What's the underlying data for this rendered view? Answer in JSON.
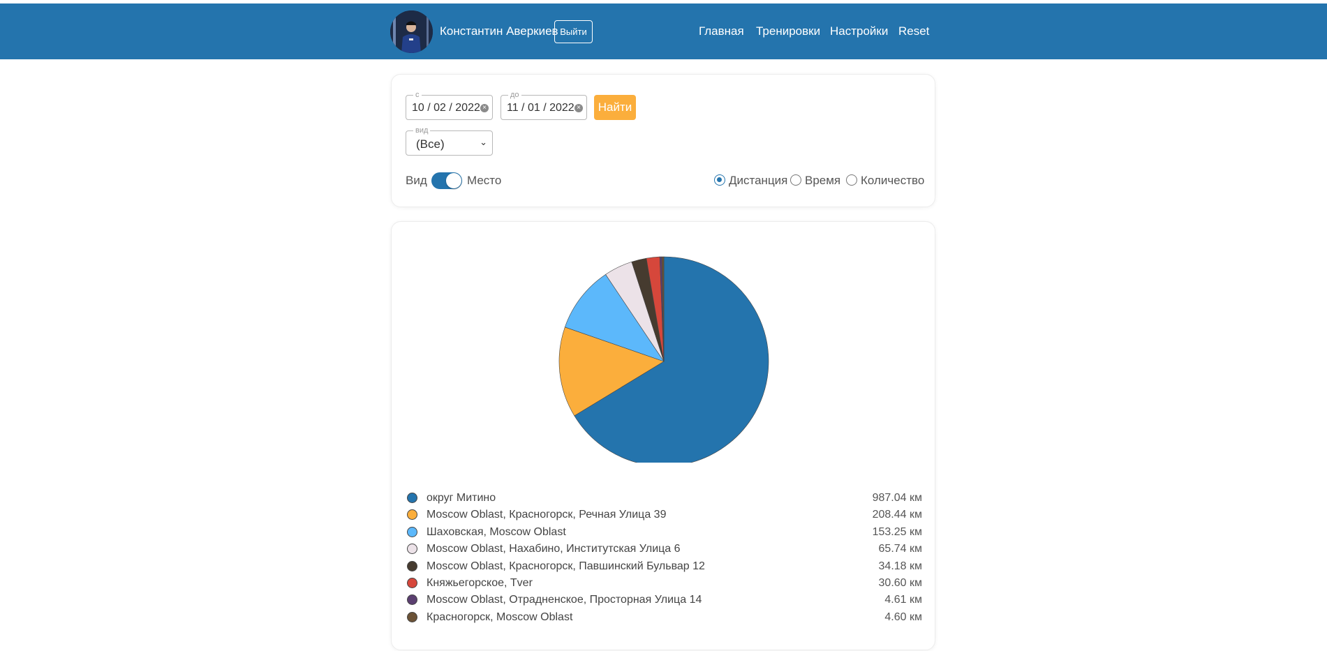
{
  "header": {
    "user_name": "Константин Аверкиев",
    "logout_label": "Выйти",
    "nav": [
      "Главная",
      "Тренировки",
      "Настройки",
      "Reset"
    ],
    "bg_color": "#2474ad"
  },
  "filters": {
    "from": {
      "label": "с",
      "month": "10",
      "day": "02",
      "year": "2022"
    },
    "to": {
      "label": "до",
      "month": "11",
      "day": "01",
      "year": "2022"
    },
    "find_label": "Найти",
    "find_color": "#fbae3c",
    "type": {
      "label": "вид",
      "value": "(Все)"
    },
    "toggle": {
      "left_label": "Вид",
      "right_label": "Место",
      "on": true
    },
    "metric_options": [
      {
        "label": "Дистанция",
        "checked": true
      },
      {
        "label": "Время",
        "checked": false
      },
      {
        "label": "Количество",
        "checked": false
      }
    ]
  },
  "chart_data": {
    "type": "pie",
    "unit": "км",
    "slices": [
      {
        "label": "округ Митино",
        "value": 987.04,
        "display": "987.04 км",
        "color": "#2474ad"
      },
      {
        "label": "Moscow Oblast, Красногорск, Речная Улица 39",
        "value": 208.44,
        "display": "208.44 км",
        "color": "#fbae3c"
      },
      {
        "label": "Шаховская, Moscow Oblast",
        "value": 153.25,
        "display": "153.25 км",
        "color": "#5cb8fb"
      },
      {
        "label": "Moscow Oblast, Нахабино, Институтская Улица 6",
        "value": 65.74,
        "display": "65.74 км",
        "color": "#ece2e8"
      },
      {
        "label": "Moscow Oblast, Красногорск, Павшинский Бульвар 12",
        "value": 34.18,
        "display": "34.18 км",
        "color": "#463b2f"
      },
      {
        "label": "Княжьегорское, Tver",
        "value": 30.6,
        "display": "30.60 км",
        "color": "#d6473b"
      },
      {
        "label": "Moscow Oblast, Отрадненское, Просторная Улица 14",
        "value": 4.61,
        "display": "4.61 км",
        "color": "#5b3f70"
      },
      {
        "label": "Красногорск, Moscow Oblast",
        "value": 4.6,
        "display": "4.60 км",
        "color": "#6b5236"
      }
    ]
  }
}
